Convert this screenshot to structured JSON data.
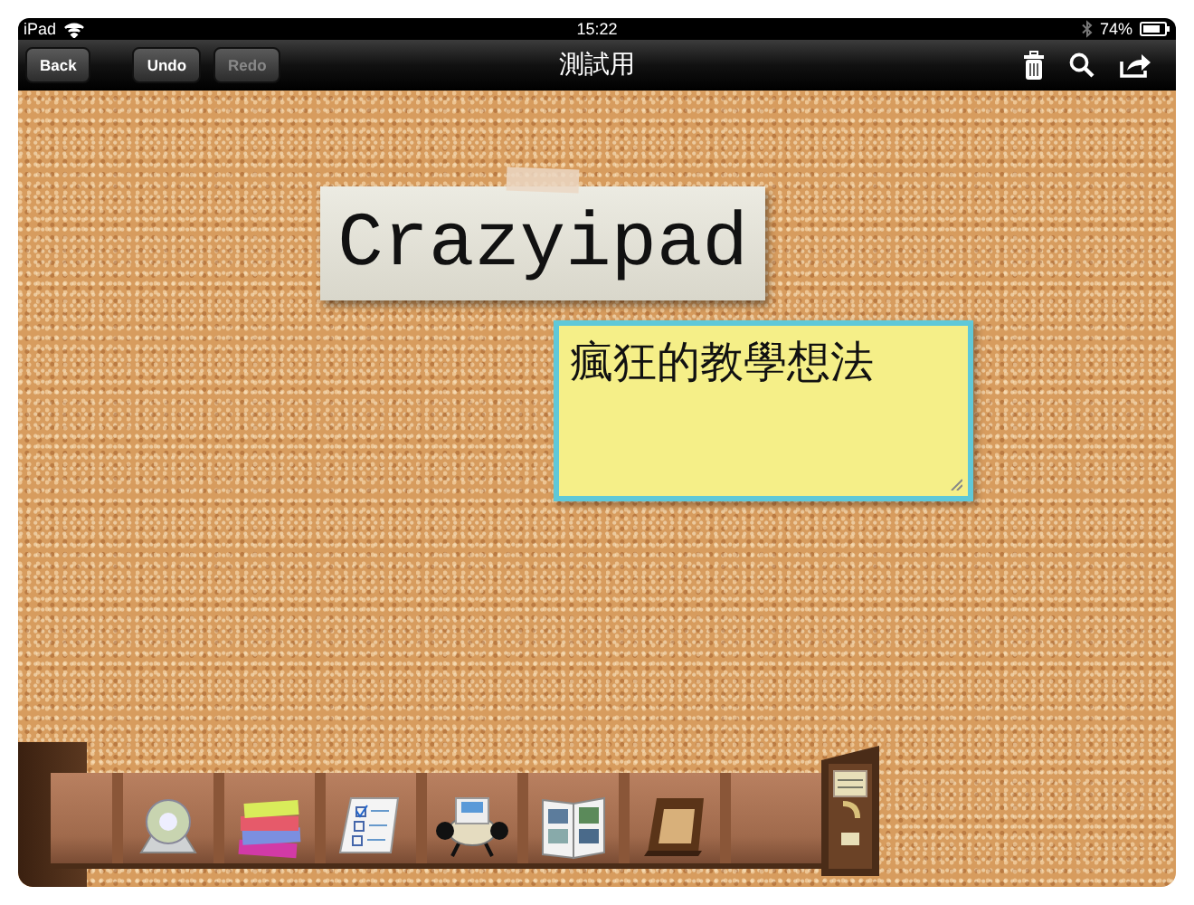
{
  "status_bar": {
    "device": "iPad",
    "time": "15:22",
    "battery": "74%"
  },
  "toolbar": {
    "title": "測試用",
    "buttons": [
      {
        "label": "Back",
        "disabled": false
      },
      {
        "label": "Undo",
        "disabled": false
      },
      {
        "label": "Redo",
        "disabled": true
      }
    ]
  },
  "board": {
    "notes": [
      {
        "kind": "label",
        "text": "Crazyipad"
      },
      {
        "kind": "sticky",
        "text": "瘋狂的教學想法"
      }
    ]
  },
  "tray": {
    "items": [
      {
        "kind": "tape"
      },
      {
        "kind": "notes"
      },
      {
        "kind": "checklist"
      },
      {
        "kind": "rolodex"
      },
      {
        "kind": "album"
      },
      {
        "kind": "frame"
      },
      {
        "kind": "empty"
      }
    ]
  }
}
